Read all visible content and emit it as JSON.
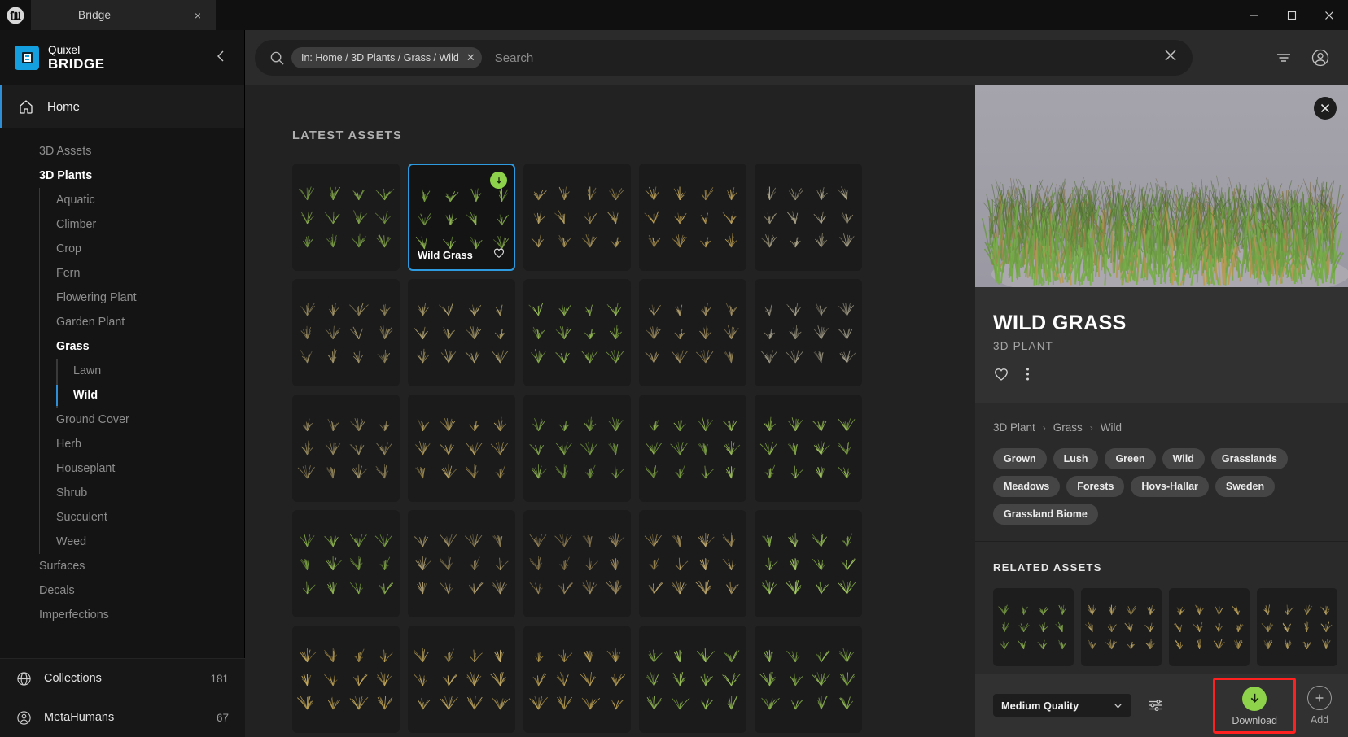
{
  "window": {
    "app_logo": "unreal-engine-logo",
    "tab_label": "Bridge",
    "tab_close": "×",
    "minimize": "—",
    "maximize": "☐",
    "close": "✕"
  },
  "brand": {
    "line1": "Quixel",
    "line2": "BRIDGE",
    "collapse_icon": "chevron-left-icon"
  },
  "sidebar": {
    "home_label": "Home",
    "home_icon": "home-icon",
    "items": [
      {
        "label": "3D Assets",
        "level": 1,
        "active": false
      },
      {
        "label": "3D Plants",
        "level": 1,
        "active": true
      },
      {
        "label": "Aquatic",
        "level": 2,
        "active": false
      },
      {
        "label": "Climber",
        "level": 2,
        "active": false
      },
      {
        "label": "Crop",
        "level": 2,
        "active": false
      },
      {
        "label": "Fern",
        "level": 2,
        "active": false
      },
      {
        "label": "Flowering Plant",
        "level": 2,
        "active": false
      },
      {
        "label": "Garden Plant",
        "level": 2,
        "active": false
      },
      {
        "label": "Grass",
        "level": 2,
        "active": true
      },
      {
        "label": "Lawn",
        "level": 3,
        "active": false
      },
      {
        "label": "Wild",
        "level": 3,
        "active": true
      },
      {
        "label": "Ground Cover",
        "level": 2,
        "active": false
      },
      {
        "label": "Herb",
        "level": 2,
        "active": false
      },
      {
        "label": "Houseplant",
        "level": 2,
        "active": false
      },
      {
        "label": "Shrub",
        "level": 2,
        "active": false
      },
      {
        "label": "Succulent",
        "level": 2,
        "active": false
      },
      {
        "label": "Weed",
        "level": 2,
        "active": false
      },
      {
        "label": "Surfaces",
        "level": 1,
        "active": false
      },
      {
        "label": "Decals",
        "level": 1,
        "active": false
      },
      {
        "label": "Imperfections",
        "level": 1,
        "active": false
      }
    ],
    "bottom": [
      {
        "label": "Collections",
        "count": "181",
        "icon": "globe-icon"
      },
      {
        "label": "MetaHumans",
        "count": "67",
        "icon": "person-circle-icon"
      }
    ]
  },
  "search": {
    "icon": "search-icon",
    "chip_label": "In: Home / 3D Plants / Grass / Wild",
    "chip_close": "✕",
    "placeholder": "Search",
    "value": "",
    "clear_icon": "close-icon",
    "filter_icon": "filter-icon",
    "account_icon": "account-icon"
  },
  "main": {
    "section_title": "LATEST ASSETS",
    "cards": [
      {
        "name": "",
        "selected": false,
        "downloaded": false,
        "palette": "green-clumps"
      },
      {
        "name": "Wild Grass",
        "selected": true,
        "downloaded": true,
        "palette": "green-wild"
      },
      {
        "name": "",
        "selected": false,
        "downloaded": false,
        "palette": "dry-tan"
      },
      {
        "name": "",
        "selected": false,
        "downloaded": false,
        "palette": "dry-gold"
      },
      {
        "name": "",
        "selected": false,
        "downloaded": false,
        "palette": "pale-sparse"
      },
      {
        "name": "",
        "selected": false,
        "downloaded": false,
        "palette": "dry-thin"
      },
      {
        "name": "",
        "selected": false,
        "downloaded": false,
        "palette": "tan-tufts"
      },
      {
        "name": "",
        "selected": false,
        "downloaded": false,
        "palette": "green-blades"
      },
      {
        "name": "",
        "selected": false,
        "downloaded": false,
        "palette": "dry-wide"
      },
      {
        "name": "",
        "selected": false,
        "downloaded": false,
        "palette": "pale-small"
      },
      {
        "name": "",
        "selected": false,
        "downloaded": false,
        "palette": "thin-stalks"
      },
      {
        "name": "",
        "selected": false,
        "downloaded": false,
        "palette": "tall-dry"
      },
      {
        "name": "",
        "selected": false,
        "downloaded": false,
        "palette": "sparse-green"
      },
      {
        "name": "",
        "selected": false,
        "downloaded": false,
        "palette": "single-blade"
      },
      {
        "name": "",
        "selected": false,
        "downloaded": false,
        "palette": "bright-green"
      },
      {
        "name": "",
        "selected": false,
        "downloaded": false,
        "palette": "fine-green"
      },
      {
        "name": "",
        "selected": false,
        "downloaded": false,
        "palette": "thin-dry"
      },
      {
        "name": "",
        "selected": false,
        "downloaded": false,
        "palette": "wispy-brown"
      },
      {
        "name": "",
        "selected": false,
        "downloaded": false,
        "palette": "fan-dry"
      },
      {
        "name": "",
        "selected": false,
        "downloaded": false,
        "palette": "lush-green"
      },
      {
        "name": "",
        "selected": false,
        "downloaded": false,
        "palette": "amber-tuft"
      },
      {
        "name": "",
        "selected": false,
        "downloaded": false,
        "palette": "amber-wide"
      },
      {
        "name": "",
        "selected": false,
        "downloaded": false,
        "palette": "amber-spread"
      },
      {
        "name": "",
        "selected": false,
        "downloaded": false,
        "palette": "green-tall"
      },
      {
        "name": "",
        "selected": false,
        "downloaded": false,
        "palette": "green-mid"
      }
    ]
  },
  "panel": {
    "close_icon": "close-icon",
    "hero_alt": "wild-grass-preview",
    "title": "WILD GRASS",
    "subtitle": "3D PLANT",
    "favorite_icon": "heart-icon",
    "more_icon": "more-vertical-icon",
    "breadcrumbs": [
      "3D Plant",
      "Grass",
      "Wild"
    ],
    "breadcrumb_sep": "›",
    "tags": [
      "Grown",
      "Lush",
      "Green",
      "Wild",
      "Grasslands",
      "Meadows",
      "Forests",
      "Hovs-Hallar",
      "Sweden",
      "Grassland Biome"
    ],
    "related_title": "RELATED ASSETS",
    "related_count": 4,
    "footer": {
      "quality_value": "Medium Quality",
      "quality_arrow": "chevron-down-icon",
      "settings_icon": "sliders-icon",
      "download_label": "Download",
      "download_icon": "download-arrow-icon",
      "add_label": "Add",
      "add_icon": "plus-icon",
      "highlight_color": "#ff2020",
      "download_accent": "#8ed14a"
    }
  },
  "colors": {
    "accent_blue": "#2e9be0",
    "brand_blue": "#14a0e0",
    "green": "#8ed14a",
    "panel_bg": "#2a2a2a",
    "main_bg": "#222222",
    "sidebar_bg": "#141414"
  }
}
